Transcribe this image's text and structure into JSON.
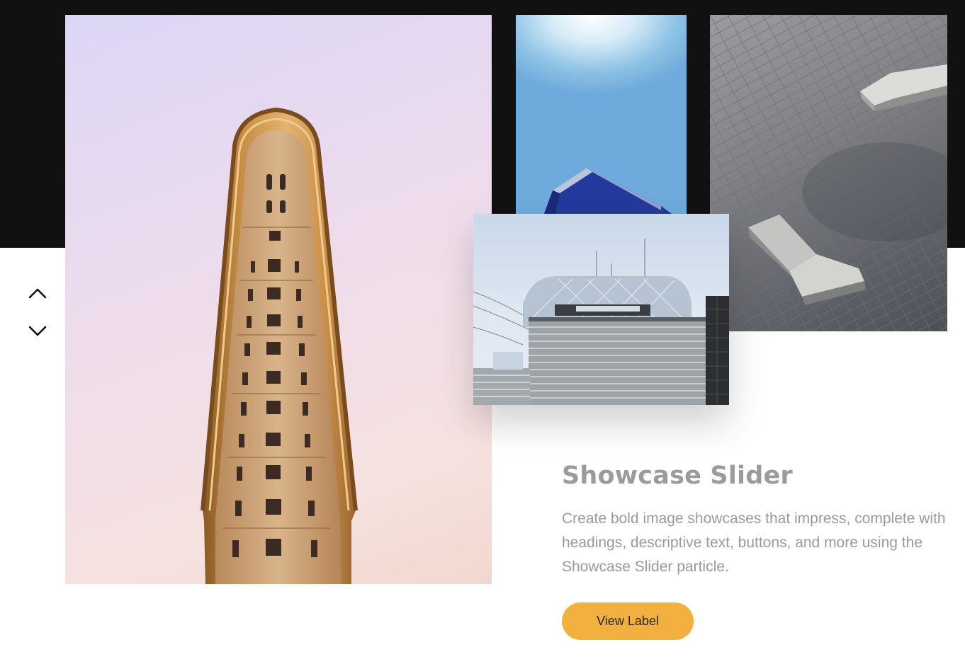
{
  "slider": {
    "title": "Showcase Slider",
    "description": "Create bold image showcases that impress, complete with headings, descriptive text, buttons, and more using the Showcase Slider particle.",
    "button_label": "View Label"
  },
  "navigation": {
    "previous_icon": "chevron-up-icon",
    "next_icon": "chevron-down-icon"
  },
  "colors": {
    "header_band": "#111111",
    "button": "#f2b13f",
    "title_text": "#9b9b9b",
    "body_text": "#9a9a9a"
  }
}
